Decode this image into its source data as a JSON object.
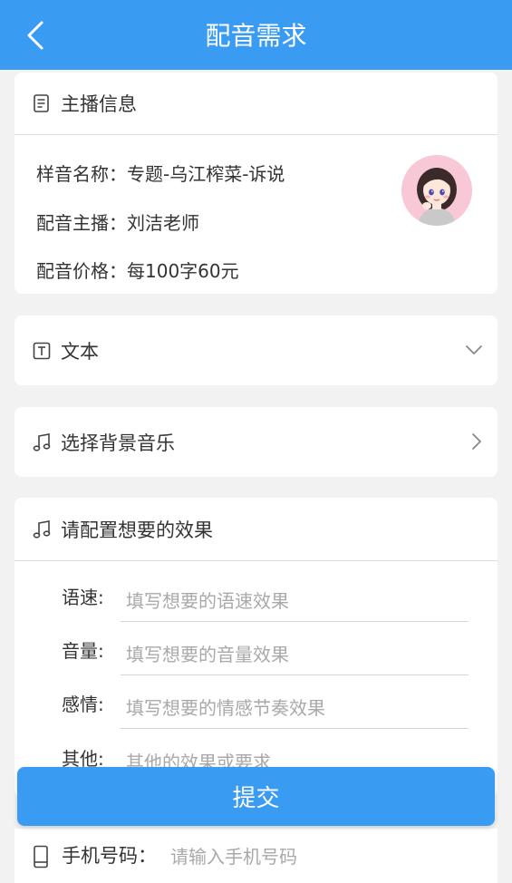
{
  "header": {
    "title": "配音需求"
  },
  "anchor_info": {
    "section_title": "主播信息",
    "sample_name_label": "样音名称：",
    "sample_name": "专题-乌江榨菜-诉说",
    "host_label": "配音主播：",
    "host": "刘洁老师",
    "price_label": "配音价格：",
    "price": "每100字60元"
  },
  "text_section": {
    "title": "文本"
  },
  "music_section": {
    "title": "选择背景音乐"
  },
  "effects": {
    "title": "请配置想要的效果",
    "fields": [
      {
        "label": "语速:",
        "placeholder": "填写想要的语速效果"
      },
      {
        "label": "音量:",
        "placeholder": "填写想要的音量效果"
      },
      {
        "label": "感情:",
        "placeholder": "填写想要的情感节奏效果"
      },
      {
        "label": "其他:",
        "placeholder": "其他的效果或要求"
      }
    ]
  },
  "submit": {
    "label": "提交"
  },
  "phone": {
    "label": "手机号码：",
    "placeholder": "请输入手机号码"
  },
  "colors": {
    "primary": "#3a9bf2",
    "background": "#f2f2f2",
    "avatar_bg": "#f9c8d6"
  }
}
